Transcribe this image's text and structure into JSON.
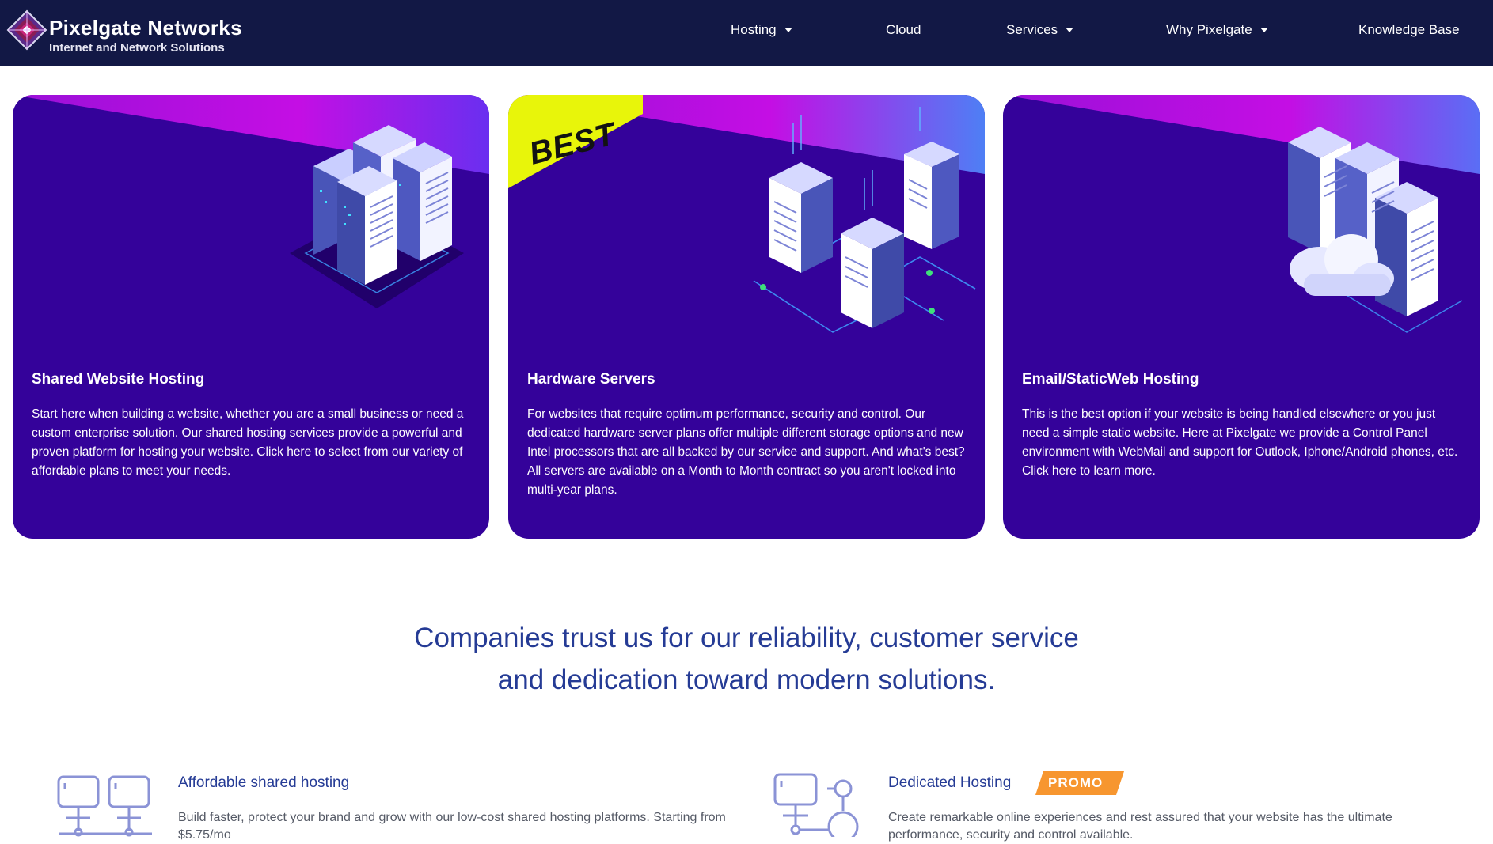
{
  "brand": {
    "title": "Pixelgate Networks",
    "subtitle": "Internet and Network Solutions",
    "logo_icon": "diamond-pixel-logo-icon"
  },
  "nav": [
    {
      "label": "Hosting",
      "has_dropdown": true
    },
    {
      "label": "Cloud",
      "has_dropdown": false
    },
    {
      "label": "Services",
      "has_dropdown": true
    },
    {
      "label": "Why Pixelgate",
      "has_dropdown": true
    },
    {
      "label": "Knowledge Base",
      "has_dropdown": false
    }
  ],
  "cards": [
    {
      "title": "Shared Website Hosting",
      "description": "Start here when building a website, whether you are a small business or need a custom enterprise solution. Our shared hosting services provide a powerful and proven platform for hosting your website. Click here to select from our variety of affordable plans to meet your needs.",
      "illustration": "server-cluster-icon"
    },
    {
      "title": "Hardware Servers",
      "description": "For websites that require optimum performance, security and control. Our dedicated hardware server plans offer multiple different storage options and new Intel processors that are all backed by our service and support. And what's best? All servers are available on a Month to Month contract so you aren't locked into multi-year plans.",
      "ribbon": "BEST",
      "illustration": "hardware-server-towers-icon"
    },
    {
      "title": "Email/StaticWeb Hosting",
      "description": "This is the best option if your website is being handled elsewhere or you just need a simple static website. Here at Pixelgate we provide a Control Panel environment with WebMail and support for Outlook, Iphone/Android phones, etc. Click here to learn more.",
      "illustration": "cloud-server-icon"
    }
  ],
  "trust": {
    "line1": "Companies trust us for our reliability, customer service",
    "line2": "and dedication toward modern solutions."
  },
  "features": [
    {
      "title": "Affordable shared hosting",
      "description": "Build faster, protect your brand and grow with our low-cost shared hosting platforms. Starting from $5.75/mo",
      "icon": "monitors-network-icon"
    },
    {
      "title": "Dedicated Hosting",
      "badge": "PROMO",
      "description": "Create remarkable online experiences and rest assured that your website has the ultimate performance, security and control available.",
      "icon": "monitor-connections-icon"
    }
  ],
  "colors": {
    "header_bg": "#121845",
    "card_bg": "#34029a",
    "accent_pink": "#c10fe0",
    "ribbon_yellow": "#e8f50a",
    "heading_blue": "#253b95",
    "promo_orange": "#f7962f"
  }
}
